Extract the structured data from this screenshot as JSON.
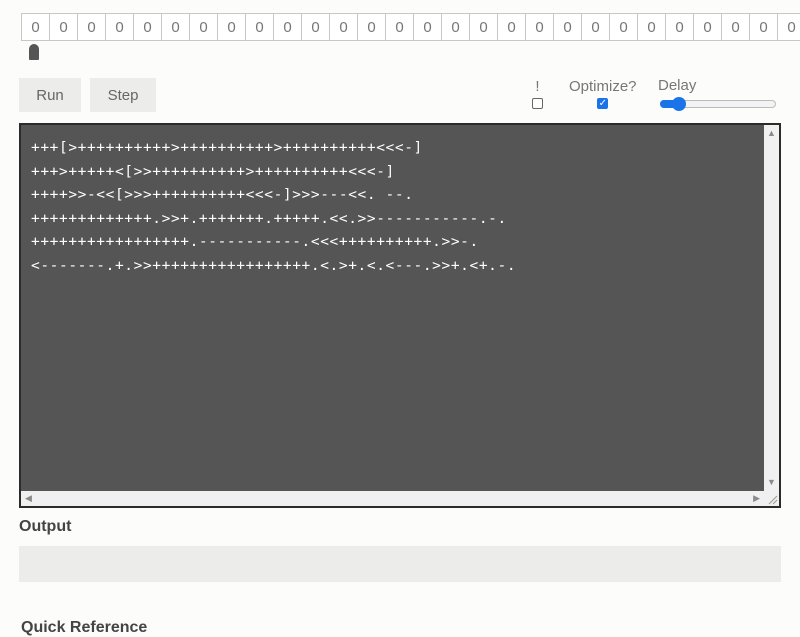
{
  "tape": {
    "cells": [
      "0",
      "0",
      "0",
      "0",
      "0",
      "0",
      "0",
      "0",
      "0",
      "0",
      "0",
      "0",
      "0",
      "0",
      "0",
      "0",
      "0",
      "0",
      "0",
      "0",
      "0",
      "0",
      "0",
      "0",
      "0",
      "0",
      "0",
      "0"
    ]
  },
  "controls": {
    "run_label": "Run",
    "step_label": "Step",
    "bang_label": "!",
    "bang_checked": false,
    "optimize_label": "Optimize?",
    "optimize_checked": true,
    "delay_label": "Delay",
    "accent": "#1a73e8"
  },
  "editor": {
    "lines": [
      "+++[>++++++++++>++++++++++>++++++++++<<<-]",
      "+++>+++++<[>>++++++++++>++++++++++<<<-]",
      "++++>>-<<[>>>++++++++++<<<-]>>>---<<. --.",
      "+++++++++++++.>>+.+++++++.+++++.<<.>>-----------.-.",
      "+++++++++++++++++.-----------.<<<++++++++++.>>-.",
      "<-------.+.>>+++++++++++++++++.<.>+.<.<---.>>+.<+.-."
    ]
  },
  "output": {
    "title": "Output",
    "text": ""
  },
  "reference": {
    "title": "Quick Reference"
  }
}
